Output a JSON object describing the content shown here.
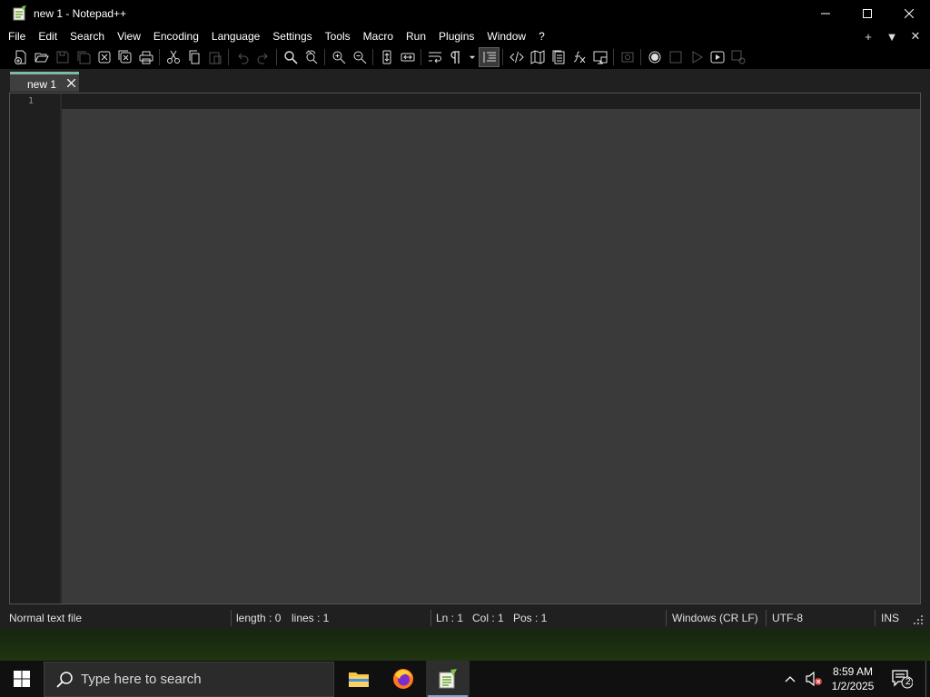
{
  "window": {
    "title": "new 1 - Notepad++"
  },
  "menu": {
    "items": [
      "File",
      "Edit",
      "Search",
      "View",
      "Encoding",
      "Language",
      "Settings",
      "Tools",
      "Macro",
      "Run",
      "Plugins",
      "Window",
      "?"
    ],
    "right_add": "+",
    "right_list": "▼",
    "right_close": "✕"
  },
  "toolbar": {
    "icons": [
      "new-file-icon",
      "open-file-icon",
      "save-icon",
      "save-all-icon",
      "close-icon",
      "close-all-icon",
      "print-icon",
      "cut-icon",
      "copy-icon",
      "paste-icon",
      "undo-icon",
      "redo-icon",
      "find-icon",
      "replace-icon",
      "zoom-in-icon",
      "zoom-out-icon",
      "sync-vertical-icon",
      "sync-horizontal-icon",
      "word-wrap-icon",
      "show-all-characters-icon",
      "indent-guide-icon",
      "xml-tag-icon",
      "document-map-icon",
      "document-list-icon",
      "function-list-icon",
      "folder-as-workspace-icon",
      "monitoring-icon",
      "record-macro-icon",
      "stop-macro-icon",
      "play-macro-icon",
      "run-macro-multiple-icon",
      "save-macro-icon"
    ]
  },
  "tabs": [
    {
      "label": "new 1",
      "active": true
    }
  ],
  "editor": {
    "line_numbers": [
      "1"
    ],
    "content": ""
  },
  "status": {
    "file_type": "Normal text file",
    "length": "length : 0",
    "lines": "lines : 1",
    "ln": "Ln : 1",
    "col": "Col : 1",
    "pos": "Pos : 1",
    "eol": "Windows (CR LF)",
    "encoding": "UTF-8",
    "mode": "INS"
  },
  "taskbar": {
    "search_placeholder": "Type here to search",
    "apps": [
      "file-explorer",
      "firefox",
      "notepad-plus-plus"
    ],
    "time": "8:59 AM",
    "date": "1/2/2025",
    "notification_count": "2"
  },
  "colors": {
    "tab_accent": "#7fb9a8",
    "editor_bg": "#3a3a3a",
    "chrome_bg": "#000000",
    "taskbar_active_underline": "#7aa8d8"
  }
}
